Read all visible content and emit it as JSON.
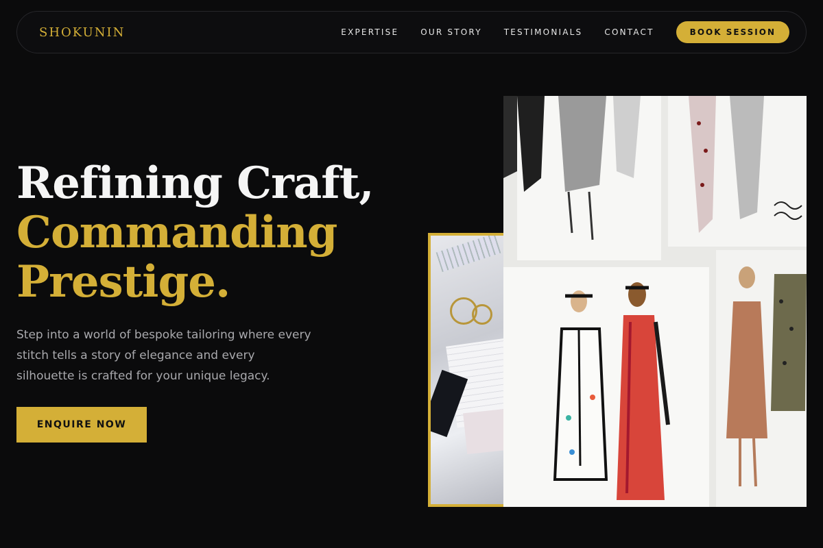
{
  "nav": {
    "brand": "SHOKUNIN",
    "links": [
      "EXPERTISE",
      "OUR STORY",
      "TESTIMONIALS",
      "CONTACT"
    ],
    "cta": "BOOK SESSION"
  },
  "hero": {
    "title_line1": "Refining Craft,",
    "title_line2": "Commanding",
    "title_line3": "Prestige.",
    "subtitle": "Step into a world of bespoke tailoring where every stitch tells a story of elegance and every silhouette is crafted for your unique legacy.",
    "cta": "ENQUIRE NOW"
  },
  "colors": {
    "background": "#0b0b0c",
    "accent": "#d4af37",
    "text": "#f5f5f5",
    "muted": "#a9a9ad"
  }
}
